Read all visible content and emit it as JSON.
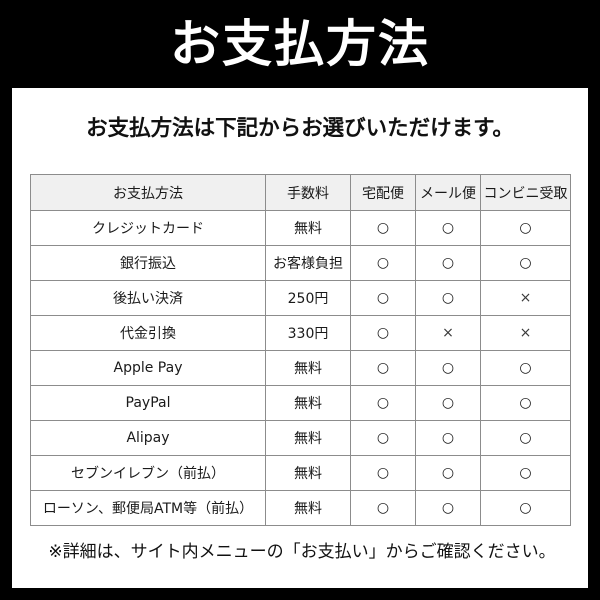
{
  "banner": {
    "title": "お支払方法"
  },
  "content": {
    "subtitle": "お支払方法は下記からお選びいただけます。",
    "footer_note": "※詳細は、サイト内メニューの「お支払い」からご確認ください。"
  },
  "table": {
    "headers": [
      "お支払方法",
      "手数料",
      "宅配便",
      "メール便",
      "コンビニ受取"
    ],
    "rows": [
      {
        "method": "クレジットカード",
        "fee": "無料",
        "takuhai": "○",
        "mail": "○",
        "conveni": "○"
      },
      {
        "method": "銀行振込",
        "fee": "お客様負担",
        "takuhai": "○",
        "mail": "○",
        "conveni": "○"
      },
      {
        "method": "後払い決済",
        "fee": "250円",
        "takuhai": "○",
        "mail": "○",
        "conveni": "×"
      },
      {
        "method": "代金引換",
        "fee": "330円",
        "takuhai": "○",
        "mail": "×",
        "conveni": "×"
      },
      {
        "method": "Apple Pay",
        "fee": "無料",
        "takuhai": "○",
        "mail": "○",
        "conveni": "○"
      },
      {
        "method": "PayPal",
        "fee": "無料",
        "takuhai": "○",
        "mail": "○",
        "conveni": "○"
      },
      {
        "method": "Alipay",
        "fee": "無料",
        "takuhai": "○",
        "mail": "○",
        "conveni": "○"
      },
      {
        "method": "セブンイレブン（前払）",
        "fee": "無料",
        "takuhai": "○",
        "mail": "○",
        "conveni": "○"
      },
      {
        "method": "ローソン、郵便局ATM等（前払）",
        "fee": "無料",
        "takuhai": "○",
        "mail": "○",
        "conveni": "○"
      }
    ]
  },
  "colors": {
    "banner_background": "#000000",
    "banner_text": "#ffffff",
    "card_background": "#ffffff",
    "table_header_background": "#f0f0f0",
    "table_border": "#8c8c8c",
    "body_text": "#1a1a1a"
  }
}
